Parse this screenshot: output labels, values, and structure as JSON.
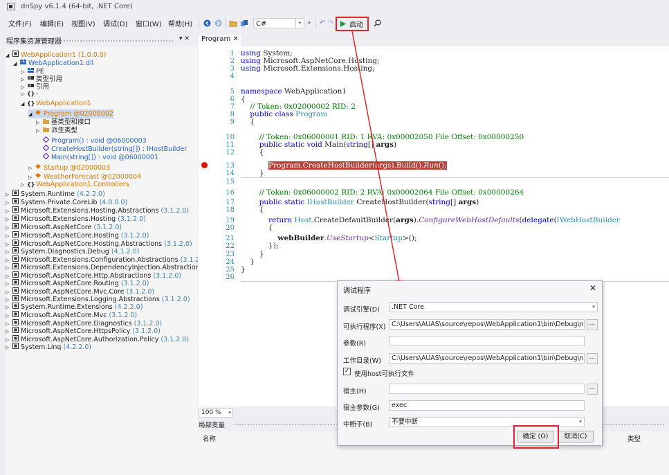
{
  "window": {
    "title": "dnSpy v6.1.4 (64-bit, .NET Core)"
  },
  "menu": [
    "文件(F)",
    "编辑(E)",
    "视图(V)",
    "调试(D)",
    "窗口(W)",
    "帮助(H)"
  ],
  "toolbar": {
    "language": "C#",
    "start_label": "启动"
  },
  "explorer": {
    "title": "程序集资源管理器",
    "pin": "▾ ✕",
    "nodes": [
      {
        "indent": 0,
        "exp": "◢",
        "icon": "assembly",
        "label": "WebApplication1",
        "extra": " (1.0.0.0)",
        "color": "orange"
      },
      {
        "indent": 1,
        "exp": "◢",
        "icon": "module",
        "label": "WebApplication1.dll",
        "extra": "",
        "color": "blue"
      },
      {
        "indent": 2,
        "exp": "▷",
        "icon": "pe",
        "label": "PE",
        "extra": "",
        "color": ""
      },
      {
        "indent": 2,
        "exp": "▷",
        "icon": "ref",
        "label": "类型引用",
        "extra": "",
        "color": ""
      },
      {
        "indent": 2,
        "exp": "▷",
        "icon": "ref",
        "label": "引用",
        "extra": "",
        "color": ""
      },
      {
        "indent": 2,
        "exp": "▷",
        "icon": "ns",
        "label": "-",
        "extra": "",
        "color": ""
      },
      {
        "indent": 2,
        "exp": "◢",
        "icon": "ns",
        "label": "WebApplication1",
        "extra": "",
        "color": "orange"
      },
      {
        "indent": 3,
        "exp": "◢",
        "icon": "class",
        "label": "Program",
        "extra": " @02000002",
        "color": "orange",
        "selected": true
      },
      {
        "indent": 4,
        "exp": "▷",
        "icon": "folder",
        "label": "基类型和接口",
        "extra": "",
        "color": ""
      },
      {
        "indent": 4,
        "exp": "▷",
        "icon": "folder",
        "label": "派生类型",
        "extra": "",
        "color": ""
      },
      {
        "indent": 4,
        "exp": "",
        "icon": "method",
        "label": "Program() : void",
        "extra": " @06000003",
        "color": "blue"
      },
      {
        "indent": 4,
        "exp": "",
        "icon": "method",
        "label": "CreateHostBuilder(string[]) : IHostBuilder",
        "extra": "",
        "color": "blue"
      },
      {
        "indent": 4,
        "exp": "",
        "icon": "method",
        "label": "Main(string[]) : void",
        "extra": " @06000001",
        "color": "blue"
      },
      {
        "indent": 3,
        "exp": "▷",
        "icon": "class",
        "label": "Startup",
        "extra": " @02000003",
        "color": "orange"
      },
      {
        "indent": 3,
        "exp": "▷",
        "icon": "class",
        "label": "WeatherForecast",
        "extra": " @02000004",
        "color": "orange"
      },
      {
        "indent": 2,
        "exp": "▷",
        "icon": "ns",
        "label": "WebApplication1.Controllers",
        "extra": "",
        "color": "orange"
      },
      {
        "indent": 0,
        "exp": "▷",
        "icon": "assembly",
        "label": "System.Runtime",
        "extra": " (4.2.2.0)",
        "color": ""
      },
      {
        "indent": 0,
        "exp": "▷",
        "icon": "assembly",
        "label": "System.Private.CoreLib",
        "extra": " (4.0.0.0)",
        "color": ""
      },
      {
        "indent": 0,
        "exp": "▷",
        "icon": "assembly",
        "label": "Microsoft.Extensions.Hosting.Abstractions",
        "extra": " (3.1.2.0)",
        "color": ""
      },
      {
        "indent": 0,
        "exp": "▷",
        "icon": "assembly",
        "label": "Microsoft.Extensions.Hosting",
        "extra": " (3.1.2.0)",
        "color": ""
      },
      {
        "indent": 0,
        "exp": "▷",
        "icon": "assembly",
        "label": "Microsoft.AspNetCore",
        "extra": " (3.1.2.0)",
        "color": ""
      },
      {
        "indent": 0,
        "exp": "▷",
        "icon": "assembly",
        "label": "Microsoft.AspNetCore.Hosting",
        "extra": " (3.1.2.0)",
        "color": ""
      },
      {
        "indent": 0,
        "exp": "▷",
        "icon": "assembly",
        "label": "Microsoft.AspNetCore.Hosting.Abstractions",
        "extra": " (3.1.2.0)",
        "color": ""
      },
      {
        "indent": 0,
        "exp": "▷",
        "icon": "assembly",
        "label": "System.Diagnostics.Debug",
        "extra": " (4.1.2.0)",
        "color": ""
      },
      {
        "indent": 0,
        "exp": "▷",
        "icon": "assembly",
        "label": "Microsoft.Extensions.Configuration.Abstractions",
        "extra": " (3.1.2.0)",
        "color": ""
      },
      {
        "indent": 0,
        "exp": "▷",
        "icon": "assembly",
        "label": "Microsoft.Extensions.DependencyInjection.Abstractions",
        "extra": "",
        "color": ""
      },
      {
        "indent": 0,
        "exp": "▷",
        "icon": "assembly",
        "label": "Microsoft.AspNetCore.Http.Abstractions",
        "extra": " (3.1.2.0)",
        "color": ""
      },
      {
        "indent": 0,
        "exp": "▷",
        "icon": "assembly",
        "label": "Microsoft.AspNetCore.Routing",
        "extra": " (3.1.2.0)",
        "color": ""
      },
      {
        "indent": 0,
        "exp": "▷",
        "icon": "assembly",
        "label": "Microsoft.AspNetCore.Mvc.Core",
        "extra": " (3.1.2.0)",
        "color": ""
      },
      {
        "indent": 0,
        "exp": "▷",
        "icon": "assembly",
        "label": "Microsoft.Extensions.Logging.Abstractions",
        "extra": " (3.1.2.0)",
        "color": ""
      },
      {
        "indent": 0,
        "exp": "▷",
        "icon": "assembly",
        "label": "System.Runtime.Extensions",
        "extra": " (4.2.2.0)",
        "color": ""
      },
      {
        "indent": 0,
        "exp": "▷",
        "icon": "assembly",
        "label": "Microsoft.AspNetCore.Mvc",
        "extra": " (3.1.2.0)",
        "color": ""
      },
      {
        "indent": 0,
        "exp": "▷",
        "icon": "assembly",
        "label": "Microsoft.AspNetCore.Diagnostics",
        "extra": " (3.1.2.0)",
        "color": ""
      },
      {
        "indent": 0,
        "exp": "▷",
        "icon": "assembly",
        "label": "Microsoft.AspNetCore.HttpsPolicy",
        "extra": " (3.1.2.0)",
        "color": ""
      },
      {
        "indent": 0,
        "exp": "▷",
        "icon": "assembly",
        "label": "Microsoft.AspNetCore.Authorization.Policy",
        "extra": " (3.1.2.0)",
        "color": ""
      },
      {
        "indent": 0,
        "exp": "▷",
        "icon": "assembly",
        "label": "System.Linq",
        "extra": " (4.2.2.0)",
        "color": ""
      }
    ]
  },
  "editor": {
    "tab_label": "Program ✕",
    "zoom": "100 %",
    "breakpoint_line": 13
  },
  "locals": {
    "title": "局部变量",
    "col_name": "名称",
    "col_type": "类型"
  },
  "dialog": {
    "title": "调试程序",
    "close": "✕",
    "engine_label": "调试引擎(D)",
    "engine_value": ".NET Core",
    "exe_label": "可执行程序(X)",
    "exe_value": "C:\\Users\\AUAS\\source\\repos\\WebApplication1\\bin\\Debug\\net",
    "args_label": "参数(R)",
    "args_value": "",
    "workdir_label": "工作目录(W)",
    "workdir_value": "C:\\Users\\AUAS\\source\\repos\\WebApplication1\\bin\\Debug\\net",
    "use_host_label": "使用host可执行文件",
    "use_host_checked": true,
    "host_label": "宿主(H)",
    "host_value": "",
    "host_args_label": "宿主参数(G)",
    "host_args_value": "exec",
    "break_label": "中断于(B)",
    "break_value": "不要中断",
    "ok_label": "确定 (O)",
    "cancel_label": "取消(C)",
    "browse": "..."
  }
}
